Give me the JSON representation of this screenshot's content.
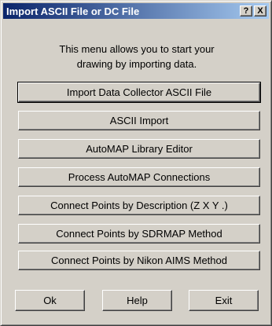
{
  "window": {
    "title": "Import ASCII File or DC File",
    "help_button": "?",
    "close_button": "X"
  },
  "description": {
    "line1": "This menu allows you to start your",
    "line2": "drawing by importing data."
  },
  "menu_buttons": [
    {
      "label": "Import Data Collector ASCII File"
    },
    {
      "label": "ASCII Import"
    },
    {
      "label": "AutoMAP Library Editor"
    },
    {
      "label": "Process AutoMAP Connections"
    },
    {
      "label": "Connect Points by Description (Z X Y .)"
    },
    {
      "label": "Connect Points by SDRMAP Method"
    },
    {
      "label": "Connect Points by Nikon AIMS Method"
    }
  ],
  "footer_buttons": {
    "ok": "Ok",
    "help": "Help",
    "exit": "Exit"
  }
}
